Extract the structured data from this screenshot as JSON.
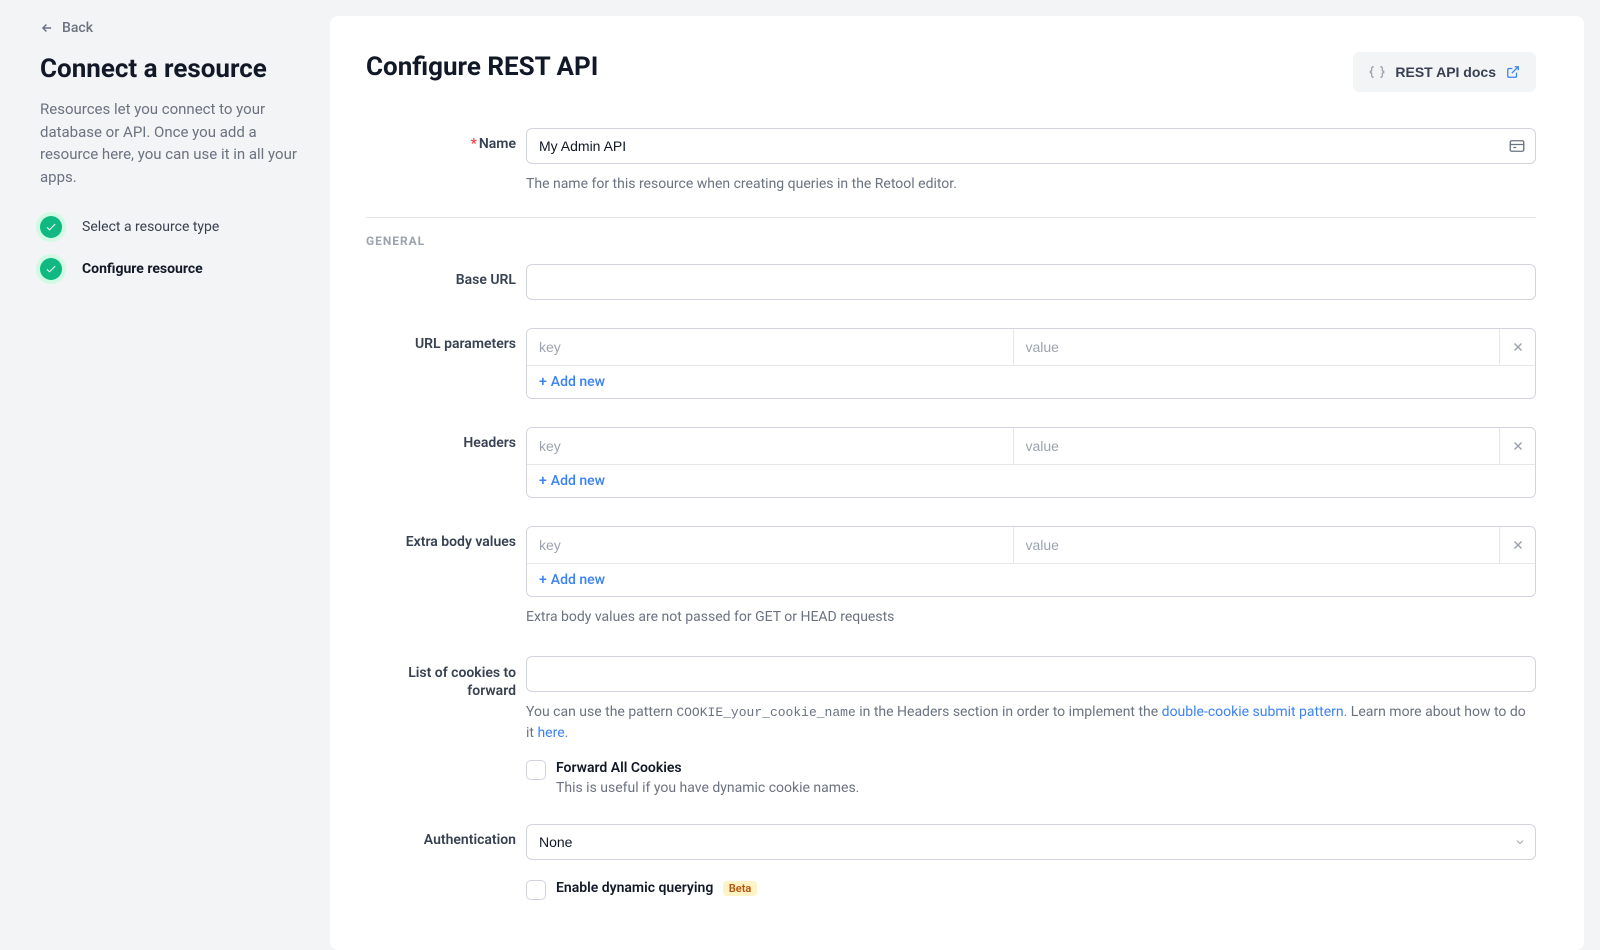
{
  "sidebar": {
    "back": "Back",
    "title": "Connect a resource",
    "description": "Resources let you connect to your database or API. Once you add a resource here, you can use it in all your apps.",
    "steps": [
      {
        "label": "Select a resource type",
        "active": false
      },
      {
        "label": "Configure resource",
        "active": true
      }
    ]
  },
  "main": {
    "title": "Configure REST API",
    "docs_button": "REST API docs",
    "name": {
      "label": "Name",
      "value": "My Admin API",
      "help": "The name for this resource when creating queries in the Retool editor."
    },
    "general_label": "GENERAL",
    "base_url": {
      "label": "Base URL"
    },
    "url_params": {
      "label": "URL parameters",
      "key_placeholder": "key",
      "value_placeholder": "value",
      "add_label": "Add new"
    },
    "headers": {
      "label": "Headers",
      "key_placeholder": "key",
      "value_placeholder": "value",
      "add_label": "Add new"
    },
    "extra_body": {
      "label": "Extra body values",
      "key_placeholder": "key",
      "value_placeholder": "value",
      "add_label": "Add new",
      "help": "Extra body values are not passed for GET or HEAD requests"
    },
    "cookies": {
      "label": "List of cookies to forward",
      "help_prefix": "You can use the pattern ",
      "help_code": "COOKIE_your_cookie_name",
      "help_mid": " in the Headers section in order to implement the ",
      "help_link1": "double-cookie submit pattern",
      "help_mid2": ". Learn more about how to do it ",
      "help_link2": "here",
      "help_suffix": "."
    },
    "forward_all": {
      "title": "Forward All Cookies",
      "sub": "This is useful if you have dynamic cookie names."
    },
    "auth": {
      "label": "Authentication",
      "value": "None"
    },
    "dynamic_querying": {
      "title": "Enable dynamic querying",
      "badge": "Beta"
    }
  }
}
